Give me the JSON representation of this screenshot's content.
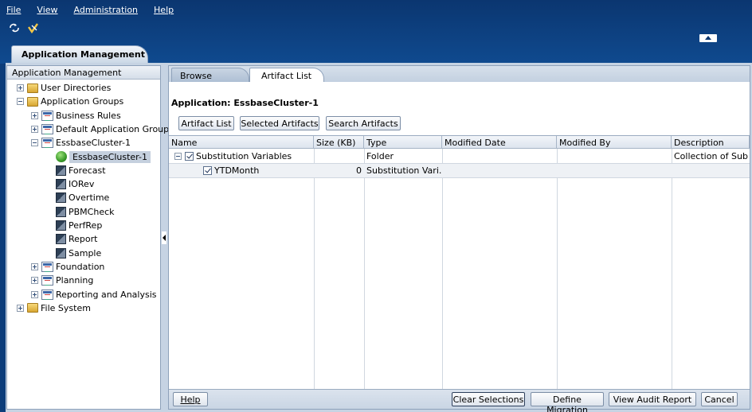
{
  "menu": {
    "file": "File",
    "view": "View",
    "administration": "Administration",
    "help": "Help"
  },
  "toolbar": {
    "icons": [
      "refresh-icon",
      "clear-icon"
    ]
  },
  "main_tab": "Application Management",
  "left_panel": {
    "header": "Application Management",
    "tree": [
      {
        "label": "User Directories",
        "icon": "folder-icon",
        "expander": "plus",
        "level": 0
      },
      {
        "label": "Application Groups",
        "icon": "folder-icon",
        "expander": "minus",
        "level": 0
      },
      {
        "label": "Business Rules",
        "icon": "app-group-icon",
        "expander": "plus",
        "level": 1
      },
      {
        "label": "Default Application Group",
        "icon": "app-group-icon",
        "expander": "plus",
        "level": 1
      },
      {
        "label": "EssbaseCluster-1",
        "icon": "app-group-icon",
        "expander": "minus",
        "level": 1
      },
      {
        "label": "EssbaseCluster-1",
        "icon": "essbase-globe-icon",
        "expander": "none",
        "level": 2,
        "selected": true
      },
      {
        "label": "Forecast",
        "icon": "database-icon",
        "expander": "none",
        "level": 2
      },
      {
        "label": "IORev",
        "icon": "database-icon",
        "expander": "none",
        "level": 2
      },
      {
        "label": "Overtime",
        "icon": "database-icon",
        "expander": "none",
        "level": 2
      },
      {
        "label": "PBMCheck",
        "icon": "database-icon",
        "expander": "none",
        "level": 2
      },
      {
        "label": "PerfRep",
        "icon": "database-icon",
        "expander": "none",
        "level": 2
      },
      {
        "label": "Report",
        "icon": "database-icon",
        "expander": "none",
        "level": 2
      },
      {
        "label": "Sample",
        "icon": "database-icon",
        "expander": "none",
        "level": 2
      },
      {
        "label": "Foundation",
        "icon": "app-group-icon",
        "expander": "plus",
        "level": 1
      },
      {
        "label": "Planning",
        "icon": "app-group-icon",
        "expander": "plus",
        "level": 1
      },
      {
        "label": "Reporting and Analysis",
        "icon": "app-group-icon",
        "expander": "plus",
        "level": 1
      },
      {
        "label": "File System",
        "icon": "folder-icon",
        "expander": "plus",
        "level": 0
      }
    ]
  },
  "right_panel": {
    "tabs": [
      "Browse",
      "Artifact List"
    ],
    "active_tab": "Artifact List",
    "application_label": "Application: EssbaseCluster-1",
    "buttons": [
      "Artifact List",
      "Selected Artifacts",
      "Search Artifacts"
    ],
    "columns": [
      "Name",
      "Size (KB)",
      "Type",
      "Modified Date",
      "Modified By",
      "Description"
    ],
    "rows": [
      {
        "name": "Substitution Variables",
        "size": "",
        "type": "Folder",
        "modified_date": "",
        "modified_by": "",
        "description": "Collection of Sub...",
        "checked": true,
        "expander": "minus"
      },
      {
        "name": "YTDMonth",
        "size": "0",
        "type": "Substitution Vari...",
        "modified_date": "",
        "modified_by": "",
        "description": "",
        "checked": true,
        "expander": "none"
      }
    ],
    "footer_buttons": [
      "Help",
      "Clear Selections",
      "Define Migration",
      "View Audit Report",
      "Cancel"
    ]
  },
  "colors": {
    "header_blue": "#0c3d7a",
    "panel_bg": "#c6d3e3",
    "selected_row": "#c5d0de"
  }
}
